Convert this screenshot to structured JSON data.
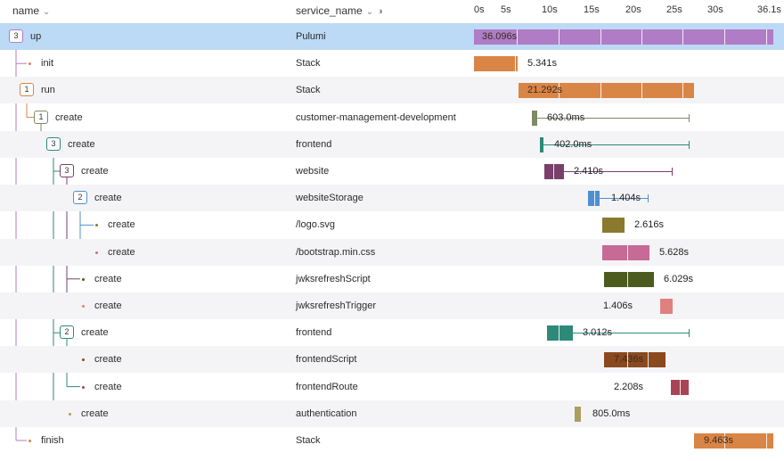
{
  "header": {
    "name_label": "name",
    "service_label": "service_name",
    "ticks": [
      "0s",
      "5s",
      "10s",
      "15s",
      "20s",
      "25s",
      "30s",
      "36.1s"
    ]
  },
  "rows": [
    {
      "name": "up",
      "service": "Pulumi",
      "badge": "3",
      "duration": "36.096s",
      "color": "#b07cc6"
    },
    {
      "name": "init",
      "service": "Stack",
      "badge": "",
      "duration": "5.341s",
      "color": "#d98545"
    },
    {
      "name": "run",
      "service": "Stack",
      "badge": "1",
      "duration": "21.292s",
      "color": "#d98545"
    },
    {
      "name": "create",
      "service": "customer-management-development",
      "badge": "1",
      "duration": "603.0ms",
      "color": "#7d8a66"
    },
    {
      "name": "create",
      "service": "frontend",
      "badge": "3",
      "duration": "402.0ms",
      "color": "#2b8a78"
    },
    {
      "name": "create",
      "service": "website",
      "badge": "3",
      "duration": "2.410s",
      "color": "#7a3f6b"
    },
    {
      "name": "create",
      "service": "websiteStorage",
      "badge": "2",
      "duration": "1.404s",
      "color": "#4f8fcf"
    },
    {
      "name": "create",
      "service": "/logo.svg",
      "badge": "",
      "duration": "2.616s",
      "color": "#8a7a2e"
    },
    {
      "name": "create",
      "service": "/bootstrap.min.css",
      "badge": "",
      "duration": "5.628s",
      "color": "#c76a95"
    },
    {
      "name": "create",
      "service": "jwksrefreshScript",
      "badge": "",
      "duration": "6.029s",
      "color": "#4e5b1f"
    },
    {
      "name": "create",
      "service": "jwksrefreshTrigger",
      "badge": "",
      "duration": "1.406s",
      "color": "#e08080"
    },
    {
      "name": "create",
      "service": "frontend",
      "badge": "2",
      "duration": "3.012s",
      "color": "#2e8a78"
    },
    {
      "name": "create",
      "service": "frontendScript",
      "badge": "",
      "duration": "7.436s",
      "color": "#8a4a1e"
    },
    {
      "name": "create",
      "service": "frontendRoute",
      "badge": "",
      "duration": "2.208s",
      "color": "#a84455"
    },
    {
      "name": "create",
      "service": "authentication",
      "badge": "",
      "duration": "805.0ms",
      "color": "#a8a060"
    },
    {
      "name": "finish",
      "service": "Stack",
      "badge": "",
      "duration": "9.463s",
      "color": "#d98545"
    }
  ]
}
